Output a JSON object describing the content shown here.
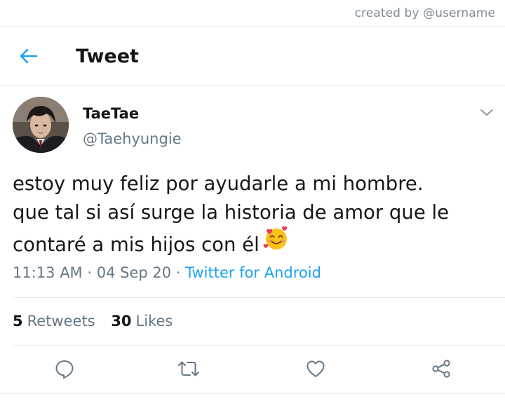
{
  "credit": "created by @username",
  "header": {
    "title": "Tweet",
    "back_icon": "arrow-left-icon"
  },
  "author": {
    "display_name": "TaeTae",
    "handle": "@Taehyungie",
    "avatar_icon": "profile-photo"
  },
  "tweet": {
    "lines": [
      "estoy muy feliz por ayudarle a mi hombre.",
      "que tal si así surge la historia de amor que le",
      "contaré a mis hijos con él"
    ],
    "emoji": "smiling-face-with-hearts-emoji",
    "time": "11:13 AM",
    "sep1": " · ",
    "date": "04 Sep 20",
    "sep2": " · ",
    "source": "Twitter for Android"
  },
  "stats": {
    "retweets_count": "5",
    "retweets_label": "Retweets",
    "likes_count": "30",
    "likes_label": "Likes"
  },
  "actions": [
    "reply-icon",
    "retweet-icon",
    "like-icon",
    "share-icon"
  ],
  "colors": {
    "accent": "#1da1f2",
    "muted": "#657786",
    "text": "#14171a",
    "divider": "#e6ecf0"
  }
}
